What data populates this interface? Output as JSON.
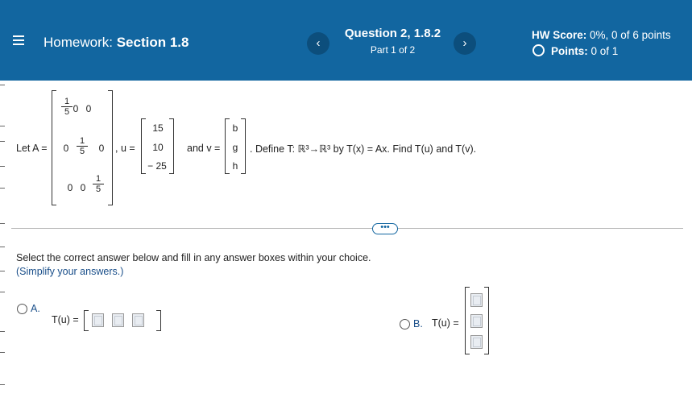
{
  "header": {
    "homework_label": "Homework:",
    "homework_section": "Section 1.8",
    "question_title": "Question 2, 1.8.2",
    "question_part": "Part 1 of 2",
    "prev_icon": "chevron-left-icon",
    "next_icon": "chevron-right-icon",
    "prev_glyph": "‹",
    "next_glyph": "›",
    "score_label": "HW Score:",
    "score_value": "0%, 0 of 6 points",
    "points_label": "Points:",
    "points_value": "0 of 1",
    "color": "#1266a0"
  },
  "problem": {
    "let_a": "Let A =",
    "matrix_a_frac_num": "1",
    "matrix_a_frac_den": "5",
    "matrix_a_zero": "0",
    "u_label": ", u =",
    "u_values": [
      "15",
      "10",
      "− 25"
    ],
    "and_v": "and v =",
    "v_values": [
      "b",
      "g",
      "h"
    ],
    "define_text": ". Define T: ℝ³→ℝ³ by T(x) = Ax. Find T(u) and T(v)."
  },
  "more_icon": "ellipsis-icon",
  "more_glyph": "•••",
  "instruction": "Select the correct answer below and fill in any answer boxes within your choice.",
  "simplify": "(Simplify your answers.)",
  "options": {
    "a": {
      "letter": "A.",
      "label": "T(u) ="
    },
    "b": {
      "letter": "B.",
      "label": "T(u) ="
    }
  }
}
